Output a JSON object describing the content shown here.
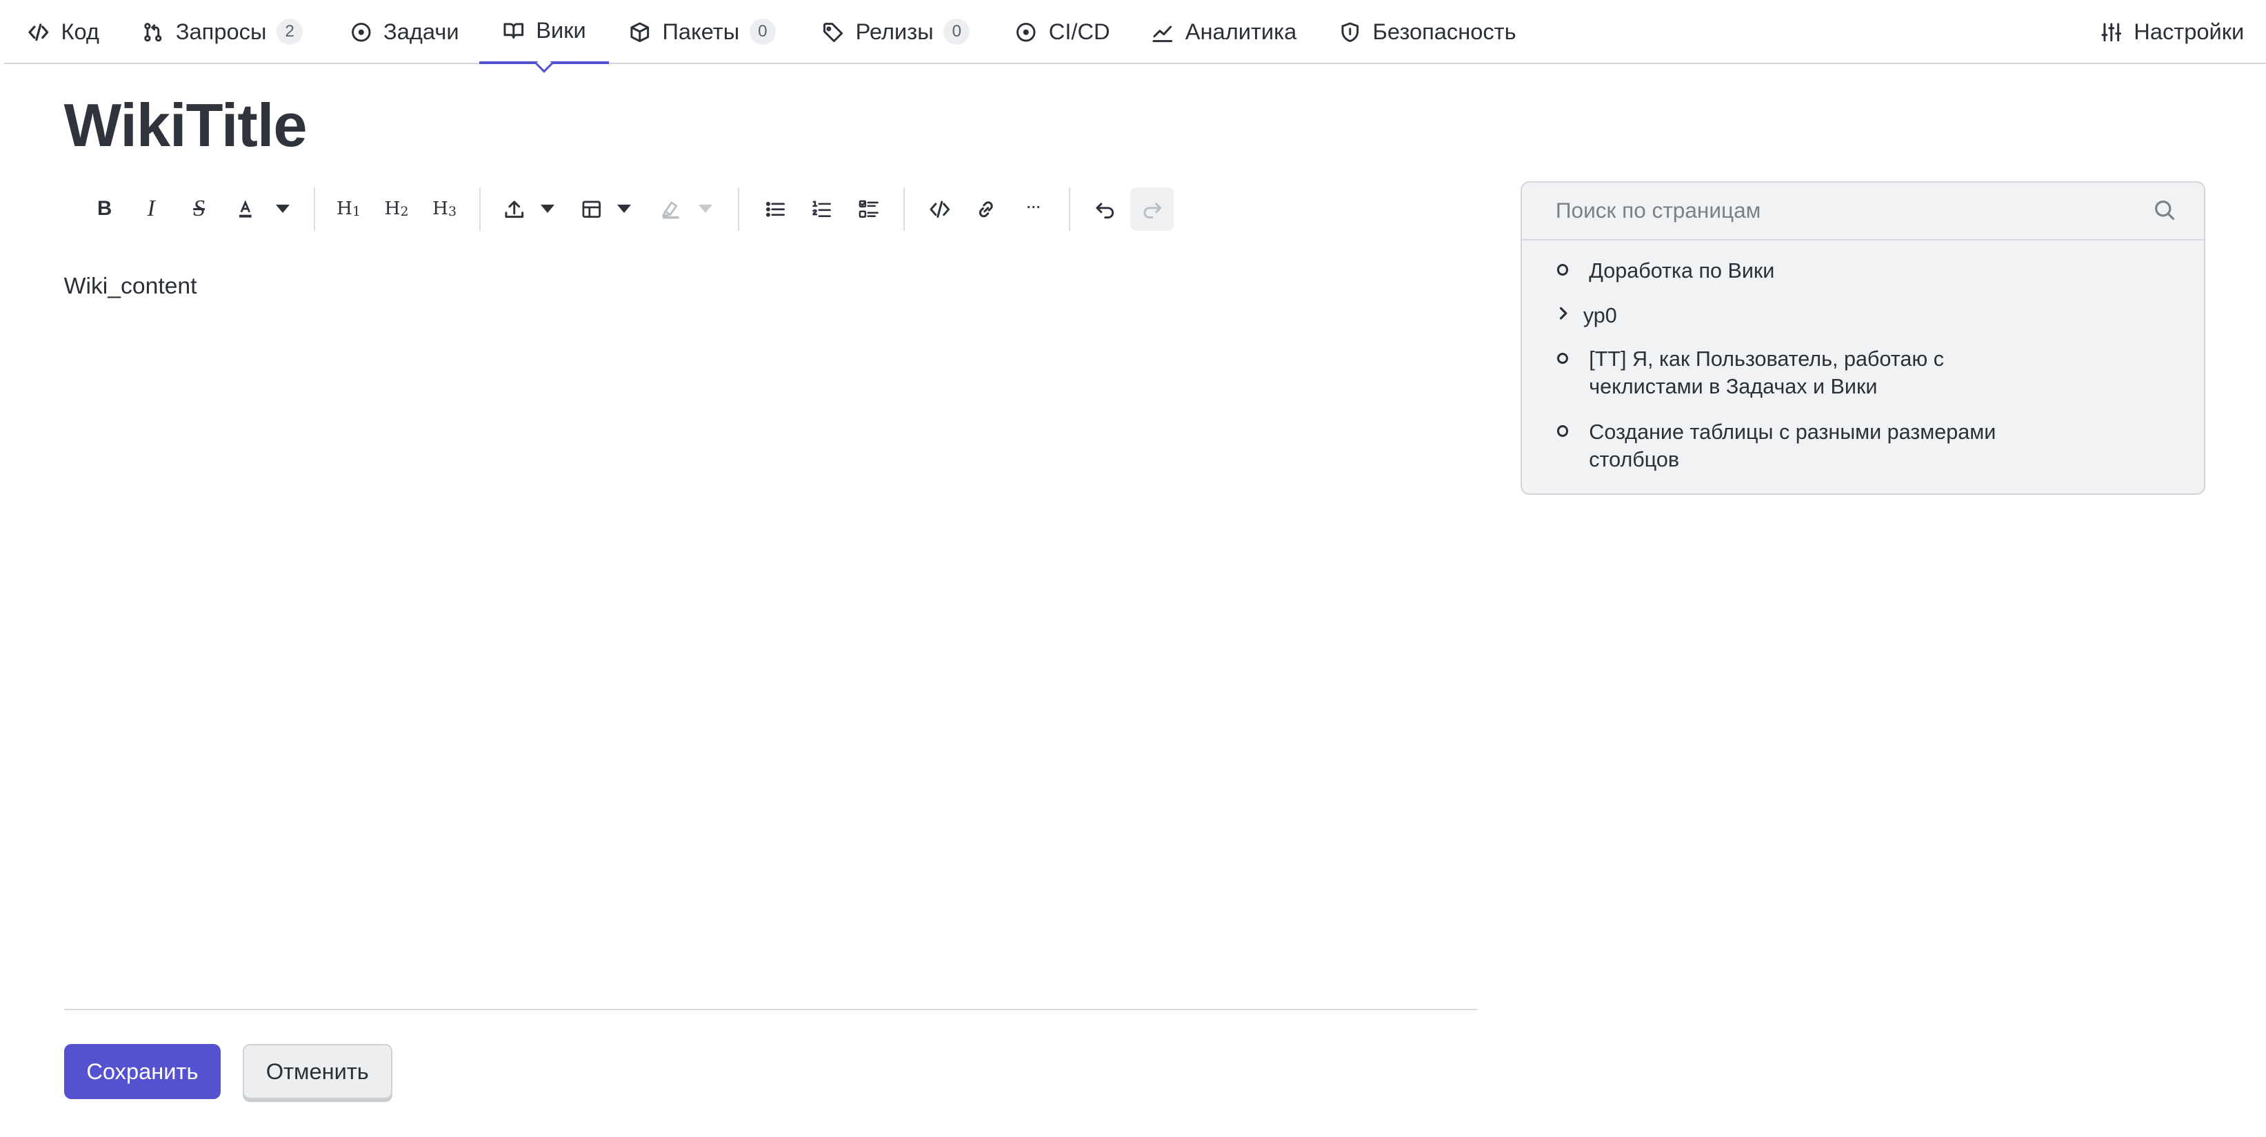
{
  "nav": {
    "tabs": [
      {
        "label": "Код",
        "icon": "code-icon"
      },
      {
        "label": "Запросы",
        "badge": "2",
        "icon": "merge-request-icon"
      },
      {
        "label": "Задачи",
        "icon": "issue-circle-icon"
      },
      {
        "label": "Вики",
        "icon": "book-icon",
        "active": true
      },
      {
        "label": "Пакеты",
        "badge": "0",
        "icon": "package-icon"
      },
      {
        "label": "Релизы",
        "badge": "0",
        "icon": "tag-icon"
      },
      {
        "label": "CI/CD",
        "icon": "pipeline-circle-icon"
      },
      {
        "label": "Аналитика",
        "icon": "chart-line-icon"
      },
      {
        "label": "Безопасность",
        "icon": "shield-icon"
      }
    ],
    "settings": {
      "label": "Настройки",
      "icon": "sliders-icon"
    }
  },
  "page": {
    "title": "WikiTitle",
    "content": "Wiki_content"
  },
  "toolbar": {
    "buttons": [
      "bold",
      "italic",
      "strikethrough",
      "text-color",
      "heading-1",
      "heading-2",
      "heading-3",
      "upload",
      "table",
      "highlight",
      "bullet-list",
      "ordered-list",
      "task-list",
      "code",
      "link",
      "more",
      "undo",
      "redo"
    ],
    "labels": {
      "bold": "B",
      "italic": "I",
      "strike": "S",
      "h": "H",
      "h1": "1",
      "h2": "2",
      "h3": "3",
      "more": "···"
    }
  },
  "actions": {
    "save_label": "Сохранить",
    "cancel_label": "Отменить"
  },
  "sidebar": {
    "search_placeholder": "Поиск по страницам",
    "pages": [
      {
        "label": "Доработка по Вики",
        "type": "bullet"
      },
      {
        "label": "ур0",
        "type": "collapsed"
      },
      {
        "label": "[TT] Я, как Пользователь, работаю с чеклистами в Задачах и Вики",
        "type": "bullet"
      },
      {
        "label": "Создание таблицы с разными размерами столбцов",
        "type": "bullet"
      }
    ]
  },
  "colors": {
    "accent": "#5452cf",
    "sidebar_bg": "#f1f2f4",
    "text": "#2b2f38"
  }
}
